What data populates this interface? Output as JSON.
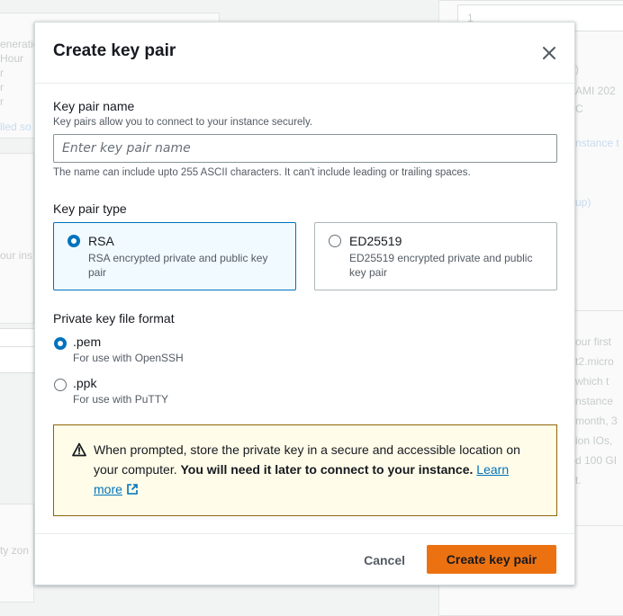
{
  "background": {
    "left_texts": [
      "eneration",
      "Hour",
      "r",
      "r",
      "r"
    ],
    "left_link": "lled so",
    "left_text2": "our ins",
    "left_text3": "ty zon",
    "right_input_value": "1",
    "right_texts": [
      ")",
      "AMI 202",
      "C",
      "nstance t",
      "up)",
      "our first",
      "t2.micro",
      "which t",
      "nstance",
      "month, 3",
      "ion IOs,",
      "d 100 GI",
      "t."
    ]
  },
  "modal": {
    "title": "Create key pair",
    "close_label": "Close",
    "key_pair_name": {
      "label": "Key pair name",
      "description": "Key pairs allow you to connect to your instance securely.",
      "placeholder": "Enter key pair name",
      "value": "",
      "constraint": "The name can include upto 255 ASCII characters. It can't include leading or trailing spaces."
    },
    "key_pair_type": {
      "label": "Key pair type",
      "options": [
        {
          "label": "RSA",
          "description": "RSA encrypted private and public key pair",
          "selected": true
        },
        {
          "label": "ED25519",
          "description": "ED25519 encrypted private and public key pair",
          "selected": false
        }
      ]
    },
    "file_format": {
      "label": "Private key file format",
      "options": [
        {
          "label": ".pem",
          "description": "For use with OpenSSH",
          "selected": true
        },
        {
          "label": ".ppk",
          "description": "For use with PuTTY",
          "selected": false
        }
      ]
    },
    "alert": {
      "text": "When prompted, store the private key in a secure and accessible location on your computer.",
      "bold_text": "You will need it later to connect to your instance.",
      "link_text": "Learn more"
    },
    "footer": {
      "cancel_label": "Cancel",
      "submit_label": "Create key pair"
    }
  },
  "colors": {
    "primary": "#ec7211",
    "selected": "#0073bb",
    "warning_bg": "#fffce9",
    "warning_border": "#8d6605"
  }
}
